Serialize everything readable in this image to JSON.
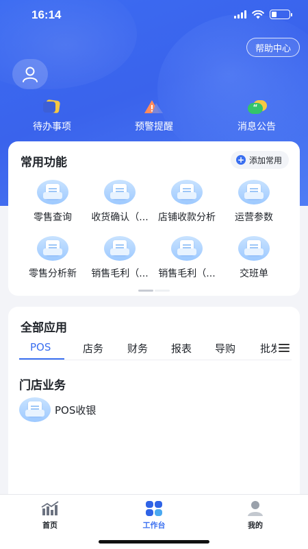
{
  "status_bar": {
    "time": "16:14"
  },
  "header": {
    "help_button": "帮助中心",
    "quick_items": [
      {
        "label": "待办事项",
        "icon": "todo-icon"
      },
      {
        "label": "预警提醒",
        "icon": "warning-icon"
      },
      {
        "label": "消息公告",
        "icon": "message-icon"
      }
    ]
  },
  "common_functions": {
    "title": "常用功能",
    "add_button": "添加常用",
    "items": [
      {
        "label": "零售查询"
      },
      {
        "label": "收货确认（..."
      },
      {
        "label": "店铺收款分析"
      },
      {
        "label": "运营参数"
      },
      {
        "label": "零售分析新"
      },
      {
        "label": "销售毛利（..."
      },
      {
        "label": "销售毛利（..."
      },
      {
        "label": "交班单"
      }
    ]
  },
  "all_apps": {
    "title": "全部应用",
    "tabs": [
      "POS",
      "店务",
      "财务",
      "报表",
      "导购",
      "批发"
    ],
    "active_tab": "POS",
    "section_title": "门店业务",
    "apps": [
      {
        "label": "POS收银"
      }
    ]
  },
  "tab_bar": {
    "items": [
      {
        "label": "首页",
        "icon": "home-chart-icon"
      },
      {
        "label": "工作台",
        "icon": "workbench-icon"
      },
      {
        "label": "我的",
        "icon": "profile-icon"
      }
    ],
    "active": "工作台"
  },
  "colors": {
    "primary": "#3a6ff0",
    "hero": "#3c6cf2"
  }
}
